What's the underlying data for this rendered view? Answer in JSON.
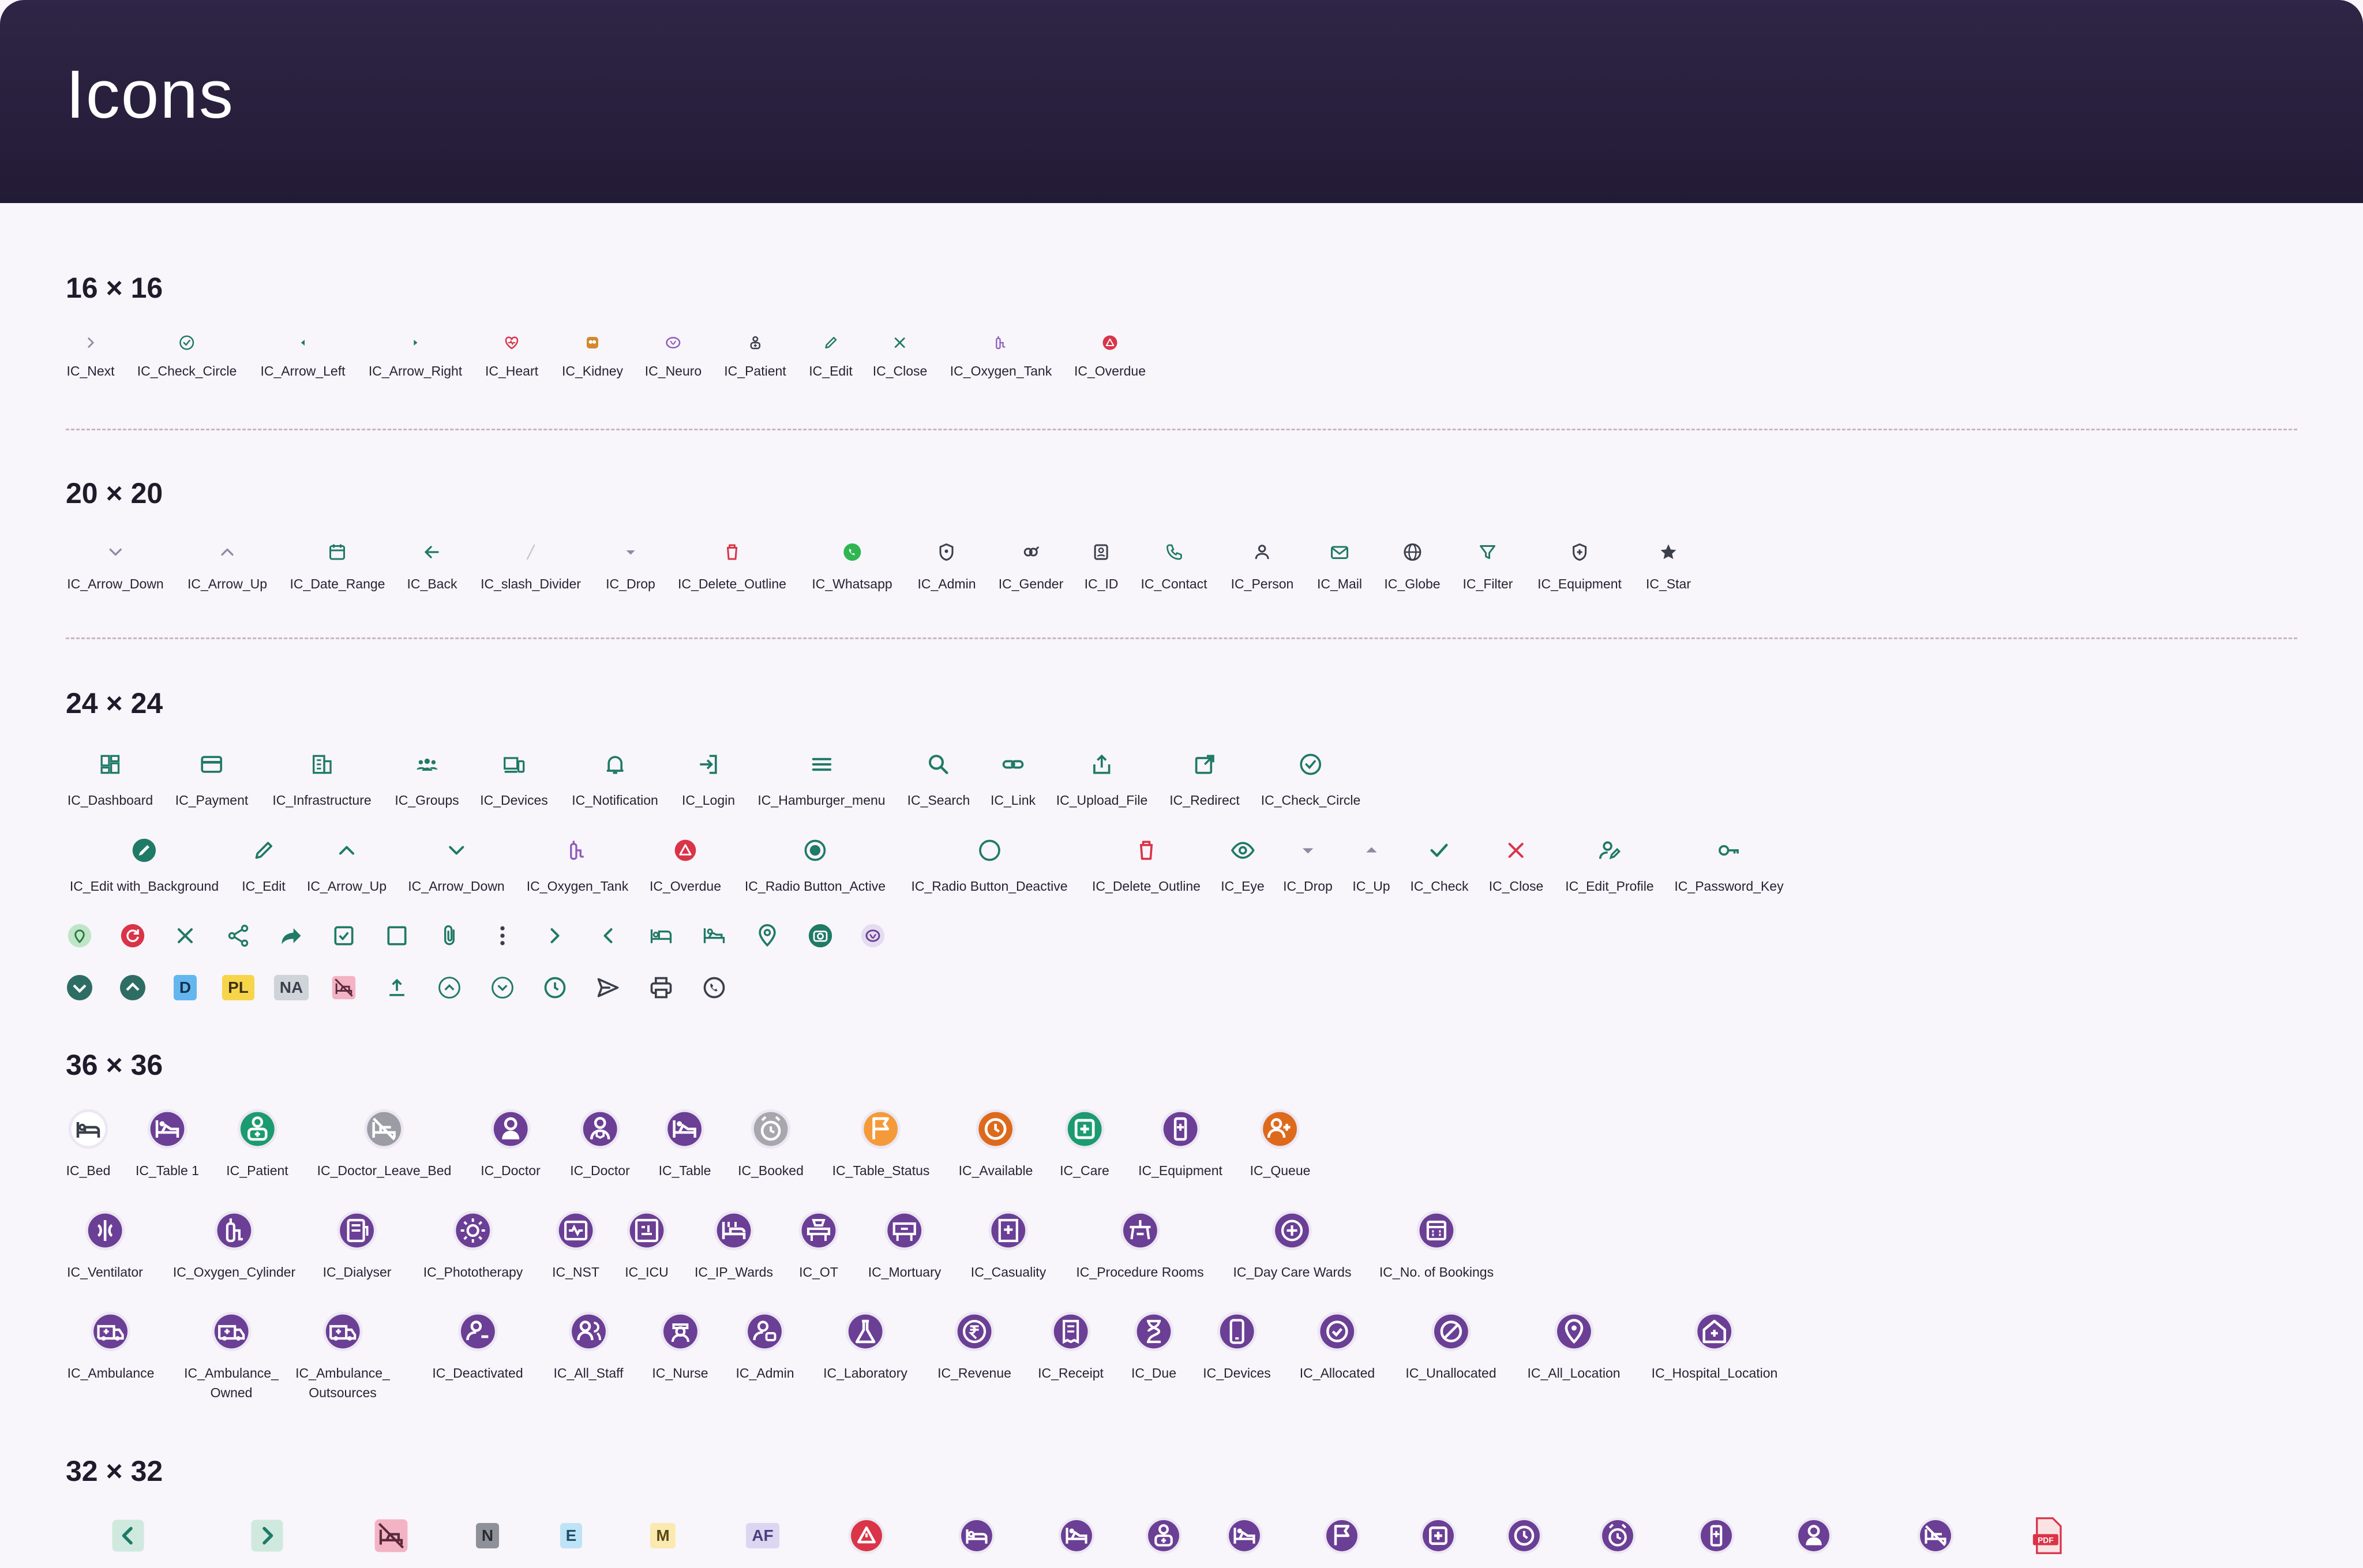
{
  "header": {
    "title": "Icons"
  },
  "sections": {
    "s16": {
      "title": "16 × 16",
      "items": [
        "IC_Next",
        "IC_Check_Circle",
        "IC_Arrow_Left",
        "IC_Arrow_Right",
        "IC_Heart",
        "IC_Kidney",
        "IC_Neuro",
        "IC_Patient",
        "IC_Edit",
        "IC_Close",
        "IC_Oxygen_Tank",
        "IC_Overdue"
      ]
    },
    "s20": {
      "title": "20 × 20",
      "items": [
        "IC_Arrow_Down",
        "IC_Arrow_Up",
        "IC_Date_Range",
        "IC_Back",
        "IC_slash_Divider",
        "IC_Drop",
        "IC_Delete_Outline",
        "IC_Whatsapp",
        "IC_Admin",
        "IC_Gender",
        "IC_ID",
        "IC_Contact",
        "IC_Person",
        "IC_Mail",
        "IC_Globe",
        "IC_Filter",
        "IC_Equipment",
        "IC_Star"
      ]
    },
    "s24": {
      "title": "24 × 24",
      "row1": [
        "IC_Dashboard",
        "IC_Payment",
        "IC_Infrastructure",
        "IC_Groups",
        "IC_Devices",
        "IC_Notification",
        "IC_Login",
        "IC_Hamburger_menu",
        "IC_Search",
        "IC_Link",
        "IC_Upload_File",
        "IC_Redirect",
        "IC_Check_Circle"
      ],
      "row2": [
        "IC_Edit with_Background",
        "IC_Edit",
        "IC_Arrow_Up",
        "IC_Arrow_Down",
        "IC_Oxygen_Tank",
        "IC_Overdue",
        "IC_Radio Button_Active",
        "IC_Radio Button_Deactive",
        "IC_Delete_Outline",
        "IC_Eye",
        "IC_Drop",
        "IC_Up",
        "IC_Check",
        "IC_Close",
        "IC_Edit_Profile",
        "IC_Password_Key"
      ],
      "badges": {
        "d": "D",
        "pl": "PL",
        "na": "NA"
      }
    },
    "s36": {
      "title": "36 × 36",
      "row1": [
        "IC_Bed",
        "IC_Table 1",
        "IC_Patient",
        "IC_Doctor_Leave_Bed",
        "IC_Doctor",
        "IC_Doctor",
        "IC_Table",
        "IC_Booked",
        "IC_Table_Status",
        "IC_Available",
        "IC_Care",
        "IC_Equipment",
        "IC_Queue"
      ],
      "row2": [
        "IC_Ventilator",
        "IC_Oxygen_Cylinder",
        "IC_Dialyser",
        "IC_Phototherapy",
        "IC_NST",
        "IC_ICU",
        "IC_IP_Wards",
        "IC_OT",
        "IC_Mortuary",
        "IC_Casuality",
        "IC_Procedure Rooms",
        "IC_Day Care Wards",
        "IC_No. of Bookings"
      ],
      "row3": [
        "IC_Ambulance",
        "IC_Ambulance_\nOwned",
        "IC_Ambulance_\nOutsources",
        "IC_Deactivated",
        "IC_All_Staff",
        "IC_Nurse",
        "IC_Admin",
        "IC_Laboratory",
        "IC_Revenue",
        "IC_Receipt",
        "IC_Due",
        "IC_Devices",
        "IC_Allocated",
        "IC_Unallocated",
        "IC_All_Location",
        "IC_Hospital_Location"
      ]
    },
    "s32": {
      "title": "32 × 32",
      "badges": {
        "n": "N",
        "e": "E",
        "m": "M",
        "af": "AF",
        "pdf": "PDF"
      }
    }
  },
  "colors": {
    "teal": "#1f7a66",
    "purple": "#6b3f95",
    "red": "#d93448",
    "header": "#261e3b"
  }
}
